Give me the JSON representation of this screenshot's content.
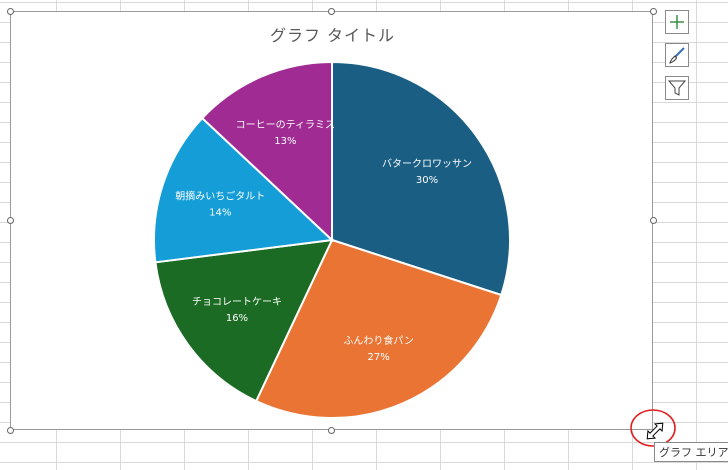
{
  "chart": {
    "title": "グラフ タイトル"
  },
  "tooltip": {
    "text": "グラフ エリア"
  },
  "side_buttons": [
    {
      "icon": "plus-icon"
    },
    {
      "icon": "brush-icon"
    },
    {
      "icon": "filter-icon"
    }
  ],
  "chart_data": {
    "type": "pie",
    "title": "グラフ タイトル",
    "slices": [
      {
        "label": "バタークロワッサン",
        "percent_label": "30%",
        "value": 30,
        "color": "#1a5e84"
      },
      {
        "label": "ふんわり食パン",
        "percent_label": "27%",
        "value": 27,
        "color": "#e97434"
      },
      {
        "label": "チョコレートケーキ",
        "percent_label": "16%",
        "value": 16,
        "color": "#1b6b24"
      },
      {
        "label": "朝摘みいちごタルト",
        "percent_label": "14%",
        "value": 14,
        "color": "#149dd7"
      },
      {
        "label": "コーヒーのティラミス",
        "percent_label": "13%",
        "value": 13,
        "color": "#a02b93"
      }
    ]
  }
}
